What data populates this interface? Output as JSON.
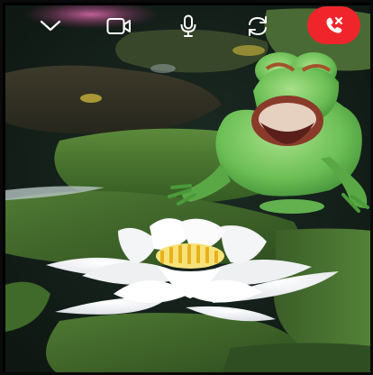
{
  "call": {
    "toolbar": {
      "collapse_icon": "chevron-down-icon",
      "camera_icon": "video-camera-icon",
      "mic_icon": "microphone-icon",
      "flip_icon": "flip-camera-icon",
      "end_call_icon": "phone-hangup-icon"
    },
    "colors": {
      "end_call": "#f0252b",
      "icon": "#ffffff"
    }
  }
}
